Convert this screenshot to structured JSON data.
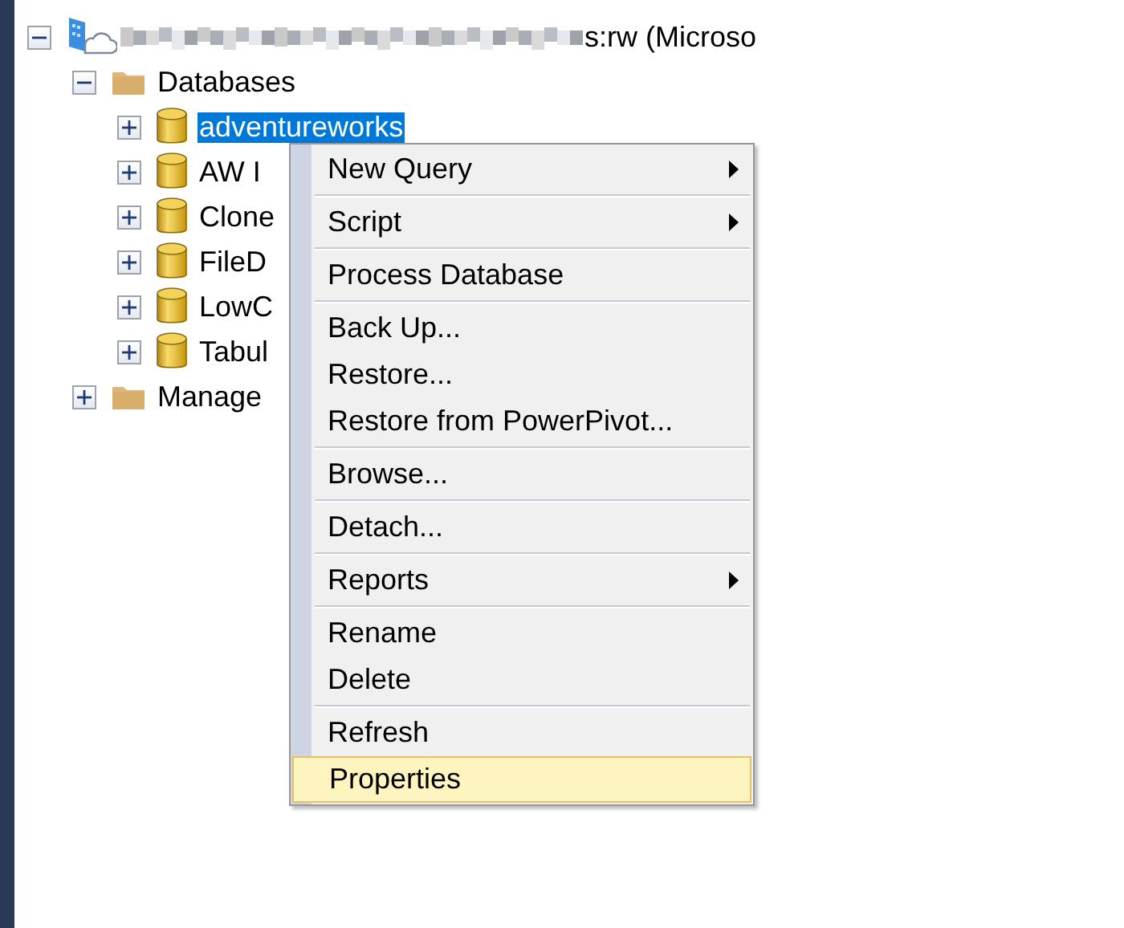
{
  "tree": [
    {
      "label": "s:rw (Microso",
      "kind": "server",
      "redacted": true,
      "expanded": true,
      "selected": false,
      "children": [
        {
          "label": "Databases",
          "kind": "folder",
          "expanded": true,
          "selected": false,
          "children": [
            {
              "label": "adventureworks",
              "kind": "database",
              "expanded": false,
              "selected": true
            },
            {
              "label": "AW I",
              "kind": "database",
              "expanded": false,
              "selected": false
            },
            {
              "label": "Clone",
              "kind": "database",
              "expanded": false,
              "selected": false
            },
            {
              "label": "FileD",
              "kind": "database",
              "expanded": false,
              "selected": false
            },
            {
              "label": "LowC",
              "kind": "database",
              "expanded": false,
              "selected": false
            },
            {
              "label": "Tabul",
              "kind": "database",
              "expanded": false,
              "selected": false
            }
          ]
        },
        {
          "label": "Manage",
          "kind": "folder",
          "expanded": false,
          "selected": false
        }
      ]
    }
  ],
  "context_menu": {
    "groups": [
      [
        {
          "label": "New Query",
          "submenu": true,
          "selected": false
        }
      ],
      [
        {
          "label": "Script",
          "submenu": true,
          "selected": false
        }
      ],
      [
        {
          "label": "Process Database",
          "submenu": false,
          "selected": false
        }
      ],
      [
        {
          "label": "Back Up...",
          "submenu": false,
          "selected": false
        },
        {
          "label": "Restore...",
          "submenu": false,
          "selected": false
        },
        {
          "label": "Restore from PowerPivot...",
          "submenu": false,
          "selected": false
        }
      ],
      [
        {
          "label": "Browse...",
          "submenu": false,
          "selected": false
        }
      ],
      [
        {
          "label": "Detach...",
          "submenu": false,
          "selected": false
        }
      ],
      [
        {
          "label": "Reports",
          "submenu": true,
          "selected": false
        }
      ],
      [
        {
          "label": "Rename",
          "submenu": false,
          "selected": false
        },
        {
          "label": "Delete",
          "submenu": false,
          "selected": false
        }
      ],
      [
        {
          "label": "Refresh",
          "submenu": false,
          "selected": false
        },
        {
          "label": "Properties",
          "submenu": false,
          "selected": true
        }
      ]
    ]
  }
}
